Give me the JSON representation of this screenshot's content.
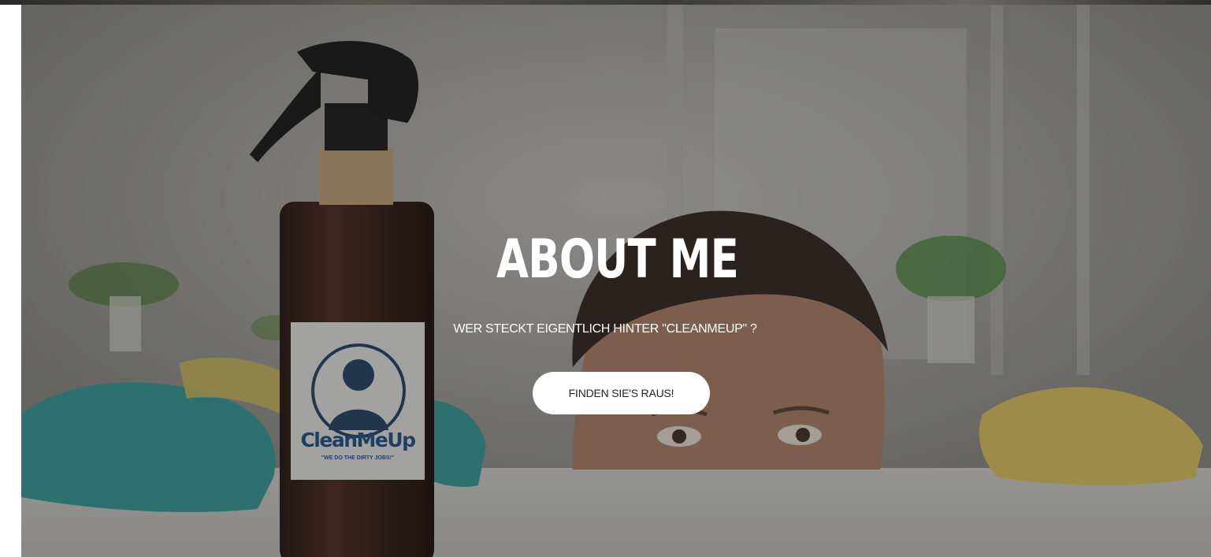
{
  "hero": {
    "title": "ABOUT ME",
    "subtitle": "WER STECKT EIGENTLICH HINTER \"CLEANMEUP\" ?",
    "cta_label": "FINDEN SIE'S RAUS!",
    "colors": {
      "overlay": "#282828",
      "title": "#ffffff",
      "button_bg": "#ffffff",
      "button_text": "#222222",
      "towel": "#2f9e9b",
      "glove": "#e8c95e",
      "bottle": "#3a1e16"
    }
  },
  "product_label": {
    "brand": "CleanMeUp",
    "tagline": "\"WE DO THE DIRTY JOBS!\""
  }
}
